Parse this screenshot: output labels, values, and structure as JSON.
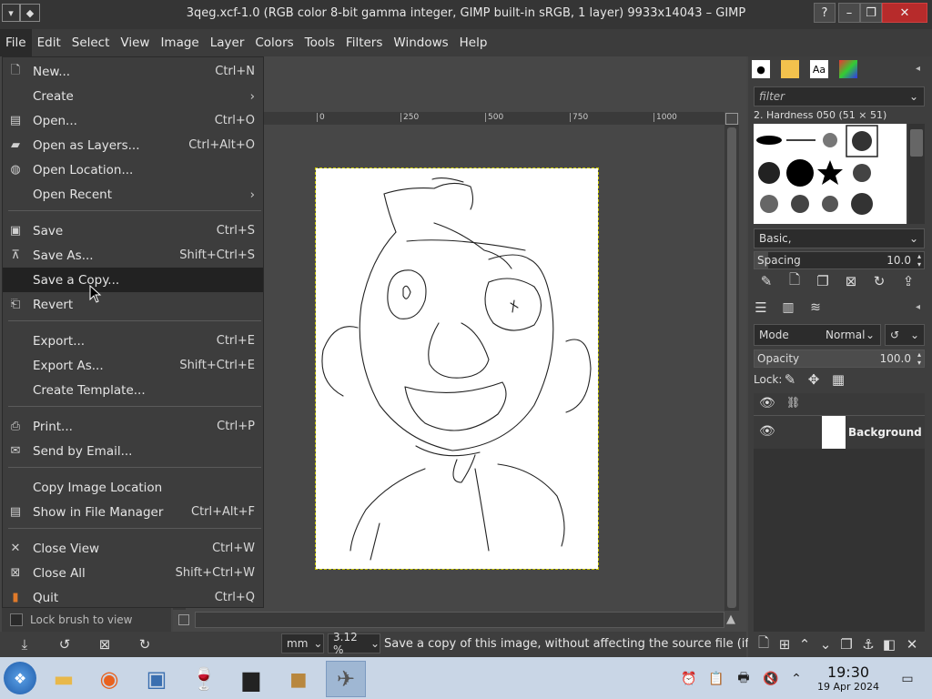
{
  "window": {
    "title": "3qeg.xcf-1.0 (RGB color 8-bit gamma integer, GIMP built-in sRGB, 1 layer) 9933x14043 – GIMP"
  },
  "menubar": [
    "File",
    "Edit",
    "Select",
    "View",
    "Image",
    "Layer",
    "Colors",
    "Tools",
    "Filters",
    "Windows",
    "Help"
  ],
  "file_menu": [
    {
      "label": "New...",
      "shortcut": "Ctrl+N",
      "icon": "new-icon"
    },
    {
      "label": "Create",
      "shortcut": "",
      "submenu": true,
      "icon": ""
    },
    {
      "label": "Open...",
      "shortcut": "Ctrl+O",
      "icon": "open-icon"
    },
    {
      "label": "Open as Layers...",
      "shortcut": "Ctrl+Alt+O",
      "icon": "layers-icon"
    },
    {
      "label": "Open Location...",
      "shortcut": "",
      "icon": "globe-icon"
    },
    {
      "label": "Open Recent",
      "shortcut": "",
      "submenu": true,
      "icon": ""
    },
    {
      "label": "Save",
      "shortcut": "Ctrl+S",
      "icon": "save-icon"
    },
    {
      "label": "Save As...",
      "shortcut": "Shift+Ctrl+S",
      "icon": "save-as-icon"
    },
    {
      "label": "Save a Copy...",
      "shortcut": "",
      "icon": "",
      "highlighted": true
    },
    {
      "label": "Revert",
      "shortcut": "",
      "icon": "revert-icon"
    },
    {
      "label": "Export...",
      "shortcut": "Ctrl+E",
      "icon": ""
    },
    {
      "label": "Export As...",
      "shortcut": "Shift+Ctrl+E",
      "icon": ""
    },
    {
      "label": "Create Template...",
      "shortcut": "",
      "icon": ""
    },
    {
      "label": "Print...",
      "shortcut": "Ctrl+P",
      "icon": "print-icon"
    },
    {
      "label": "Send by Email...",
      "shortcut": "",
      "icon": "email-icon"
    },
    {
      "label": "Copy Image Location",
      "shortcut": "",
      "icon": ""
    },
    {
      "label": "Show in File Manager",
      "shortcut": "Ctrl+Alt+F",
      "icon": "file-manager-icon"
    },
    {
      "label": "Close View",
      "shortcut": "Ctrl+W",
      "icon": "close-icon"
    },
    {
      "label": "Close All",
      "shortcut": "Shift+Ctrl+W",
      "icon": "close-all-icon"
    },
    {
      "label": "Quit",
      "shortcut": "Ctrl+Q",
      "icon": "quit-icon"
    }
  ],
  "ruler": [
    "0",
    "250",
    "500",
    "750",
    "1000"
  ],
  "toolbox": {
    "lock_brush_label": "Lock brush to view"
  },
  "status": {
    "unit": "mm",
    "zoom": "3.12 %",
    "message": "Save a copy of this image, without affecting the source file (if..."
  },
  "brushes": {
    "filter_placeholder": "filter",
    "current_brush": "2. Hardness 050 (51 × 51)",
    "tag": "Basic,",
    "spacing_label": "Spacing",
    "spacing_value": "10.0"
  },
  "layers": {
    "mode_label": "Mode",
    "mode_value": "Normal",
    "opacity_label": "Opacity",
    "opacity_value": "100.0",
    "lock_label": "Lock:",
    "items": [
      {
        "name": "Background"
      }
    ]
  },
  "taskbar": {
    "time": "19:30",
    "date": "19 Apr 2024"
  },
  "colors": {
    "menu_bg": "#3d3d3d",
    "highlight": "#222222",
    "taskbar": "#c9d6e6"
  }
}
